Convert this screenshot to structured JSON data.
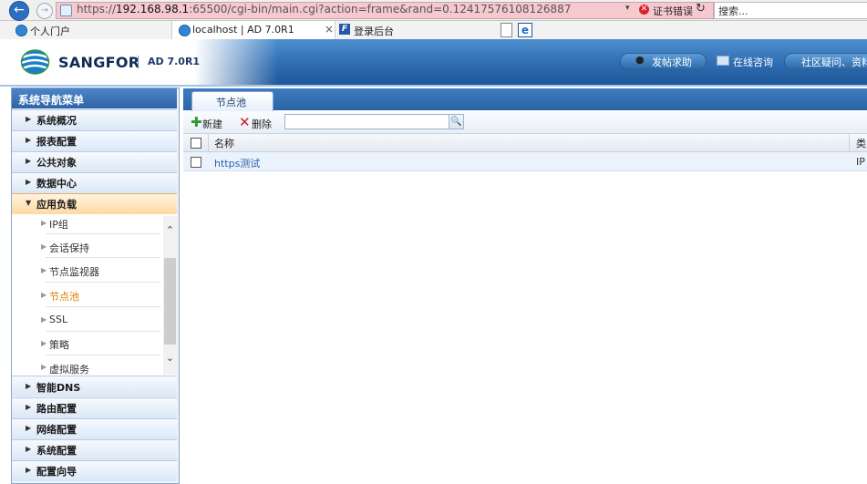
{
  "browser": {
    "url_prefix": "https://",
    "url_host": "192.168.98.1",
    "url_rest": ":65500/cgi-bin/main.cgi?action=frame&rand=0.12417576108126887",
    "dropdown": "▾",
    "cert_error": "证书错误",
    "refresh": "↻",
    "search_placeholder": "搜索..."
  },
  "tabs": {
    "favorite": "个人门户",
    "active_tab": "localhost | AD 7.0R1",
    "close": "×",
    "second_tab": "登录后台"
  },
  "header": {
    "brand": "SANGFOR",
    "version": "AD 7.0R1",
    "help": "发帖求助",
    "consult": "在线咨询",
    "forum": "社区疑问、资料"
  },
  "nav": {
    "title": "系统导航菜单",
    "items_top": [
      {
        "label": "系统概况",
        "arrow": "▶"
      },
      {
        "label": "报表配置",
        "arrow": "▶"
      },
      {
        "label": "公共对象",
        "arrow": "▶"
      },
      {
        "label": "数据中心",
        "arrow": "▶"
      },
      {
        "label": "应用负载",
        "arrow": "▼"
      }
    ],
    "subitems": [
      {
        "label": "IP组",
        "arrow": "▶"
      },
      {
        "label": "会话保持",
        "arrow": "▶"
      },
      {
        "label": "节点监视器",
        "arrow": "▶"
      },
      {
        "label": "节点池",
        "arrow": "▶"
      },
      {
        "label": "SSL",
        "arrow": "▶"
      },
      {
        "label": "策略",
        "arrow": "▶"
      },
      {
        "label": "虚拟服务",
        "arrow": "▶"
      }
    ],
    "items_bottom": [
      {
        "label": "智能DNS",
        "arrow": "▶"
      },
      {
        "label": "路由配置",
        "arrow": "▶"
      },
      {
        "label": "网络配置",
        "arrow": "▶"
      },
      {
        "label": "系统配置",
        "arrow": "▶"
      },
      {
        "label": "配置向导",
        "arrow": "▶"
      }
    ],
    "scroll_up": "⌃",
    "scroll_down": "⌄"
  },
  "main": {
    "tab": "节点池",
    "toolbar": {
      "new_icon": "✚",
      "new_label": "新建",
      "delete_icon": "✕",
      "delete_label": "删除",
      "filter_value": "",
      "search_icon": "🔍"
    },
    "columns": [
      "名称",
      "类"
    ],
    "rows": [
      {
        "name": "https测试",
        "type": "IP"
      }
    ]
  }
}
